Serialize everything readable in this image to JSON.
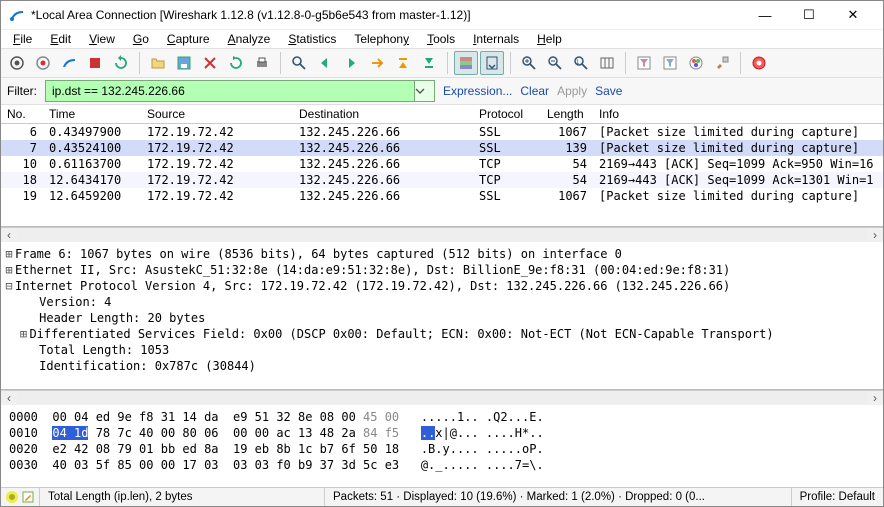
{
  "window": {
    "title": "*Local Area Connection   [Wireshark 1.12.8  (v1.12.8-0-g5b6e543 from master-1.12)]"
  },
  "menu": {
    "file": "File",
    "edit": "Edit",
    "view": "View",
    "go": "Go",
    "capture": "Capture",
    "analyze": "Analyze",
    "statistics": "Statistics",
    "telephony": "Telephony",
    "tools": "Tools",
    "internals": "Internals",
    "help": "Help"
  },
  "filter": {
    "label": "Filter:",
    "value": "ip.dst == 132.245.226.66",
    "expression": "Expression...",
    "clear": "Clear",
    "apply": "Apply",
    "save": "Save"
  },
  "columns": {
    "no": "No.",
    "time": "Time",
    "source": "Source",
    "destination": "Destination",
    "protocol": "Protocol",
    "length": "Length",
    "info": "Info"
  },
  "packets": [
    {
      "no": "6",
      "time": "0.43497900",
      "src": "172.19.72.42",
      "dst": "132.245.226.66",
      "proto": "SSL",
      "len": "1067",
      "info": "[Packet size limited during capture]",
      "sel": false
    },
    {
      "no": "7",
      "time": "0.43524100",
      "src": "172.19.72.42",
      "dst": "132.245.226.66",
      "proto": "SSL",
      "len": "139",
      "info": "[Packet size limited during capture]",
      "sel": true
    },
    {
      "no": "10",
      "time": "0.61163700",
      "src": "172.19.72.42",
      "dst": "132.245.226.66",
      "proto": "TCP",
      "len": "54",
      "info": "2169→443 [ACK] Seq=1099 Ack=950 Win=16",
      "sel": false
    },
    {
      "no": "18",
      "time": "12.6434170",
      "src": "172.19.72.42",
      "dst": "132.245.226.66",
      "proto": "TCP",
      "len": "54",
      "info": "2169→443 [ACK] Seq=1099 Ack=1301 Win=1",
      "sel": false
    },
    {
      "no": "19",
      "time": "12.6459200",
      "src": "172.19.72.42",
      "dst": "132.245.226.66",
      "proto": "SSL",
      "len": "1067",
      "info": "[Packet size limited during capture]",
      "sel": false
    }
  ],
  "details": {
    "l0": "Frame 6: 1067 bytes on wire (8536 bits), 64 bytes captured (512 bits) on interface 0",
    "l1": "Ethernet II, Src: AsustekC_51:32:8e (14:da:e9:51:32:8e), Dst: BillionE_9e:f8:31 (00:04:ed:9e:f8:31)",
    "l2": "Internet Protocol Version 4, Src: 172.19.72.42 (172.19.72.42), Dst: 132.245.226.66 (132.245.226.66)",
    "l3": "Version: 4",
    "l4": "Header Length: 20 bytes",
    "l5": "Differentiated Services Field: 0x00 (DSCP 0x00: Default; ECN: 0x00: Not-ECT (Not ECN-Capable Transport)",
    "l6": "Total Length: 1053",
    "l7": "Identification: 0x787c (30844)"
  },
  "hex": {
    "r0off": "0000",
    "r0hex": "00 04 ed 9e f8 31 14 da  e9 51 32 8e 08 00 ",
    "r0hexdim": "45 00",
    "r0asc": ".....1.. .Q2...E.",
    "r1off": "0010",
    "r1sel": "04 1d",
    "r1hex": " 78 7c 40 00 80 06  00 00 ac 13 48 2a ",
    "r1hexdim": "84 f5",
    "r1ascsel": "..",
    "r1asc": "x|@... ....H*..",
    "r2off": "0020",
    "r2hex": "e2 42 08 79 01 bb ed 8a  19 eb 8b 1c b7 6f 50 18",
    "r2asc": ".B.y.... .....oP.",
    "r3off": "0030",
    "r3hex": "40 03 5f 85 00 00 17 03  03 03 f0 b9 37 3d 5c e3",
    "r3asc": "@._..... ....7=\\."
  },
  "status": {
    "field": "Total Length (ip.len), 2 bytes",
    "packets": "Packets: 51 · Displayed: 10 (19.6%) · Marked: 1 (2.0%) · Dropped: 0 (0...",
    "profile": "Profile: Default"
  },
  "colors": {
    "filter_ok": "#b3ffb3",
    "selected_row": "#d2dcf8"
  }
}
